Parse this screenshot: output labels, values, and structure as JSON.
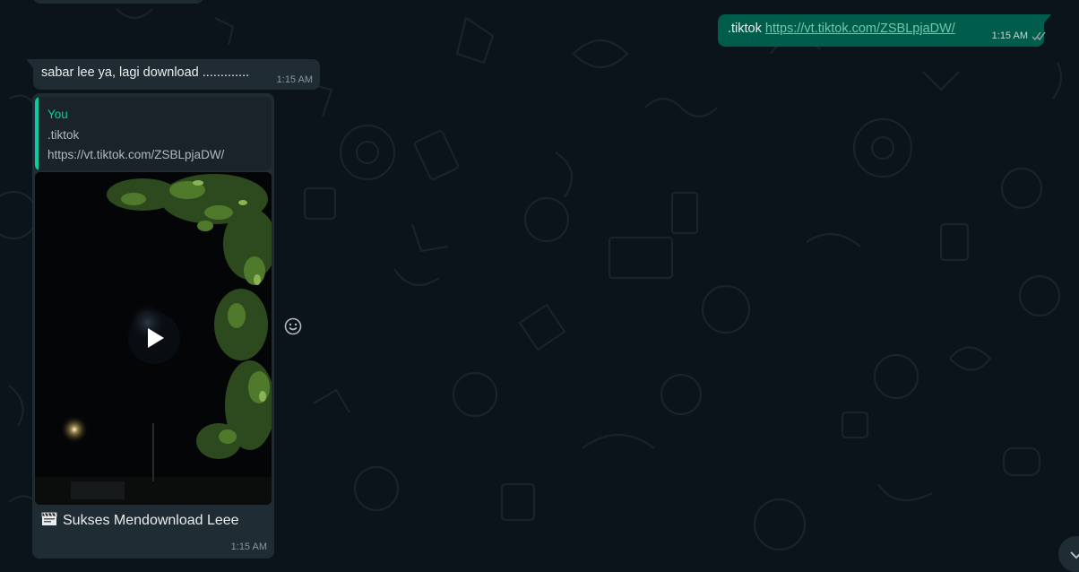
{
  "outgoing_message": {
    "command": ".tiktok",
    "link": "https://vt.tiktok.com/ZSBLpjaDW/",
    "time": "1:15 AM",
    "status_icon": "double-check-icon"
  },
  "incoming_status_message": {
    "text": "sabar lee ya, lagi download .............",
    "time": "1:15 AM"
  },
  "incoming_video_message": {
    "quoted": {
      "author": "You",
      "line1": ".tiktok",
      "line2": "https://vt.tiktok.com/ZSBLpjaDW/"
    },
    "video_thumbnail_icon": "play-icon",
    "caption_icon": "clapper-board-icon",
    "caption": "Sukses Mendownload Leee",
    "time": "1:15 AM"
  },
  "controls": {
    "react_icon": "emoji-smile-icon",
    "scroll_icon": "chevron-down-icon"
  },
  "colors": {
    "background": "#0b141a",
    "outgoing_bubble": "#005c4b",
    "incoming_bubble": "#202c33",
    "quote_accent": "#06cf9c"
  }
}
